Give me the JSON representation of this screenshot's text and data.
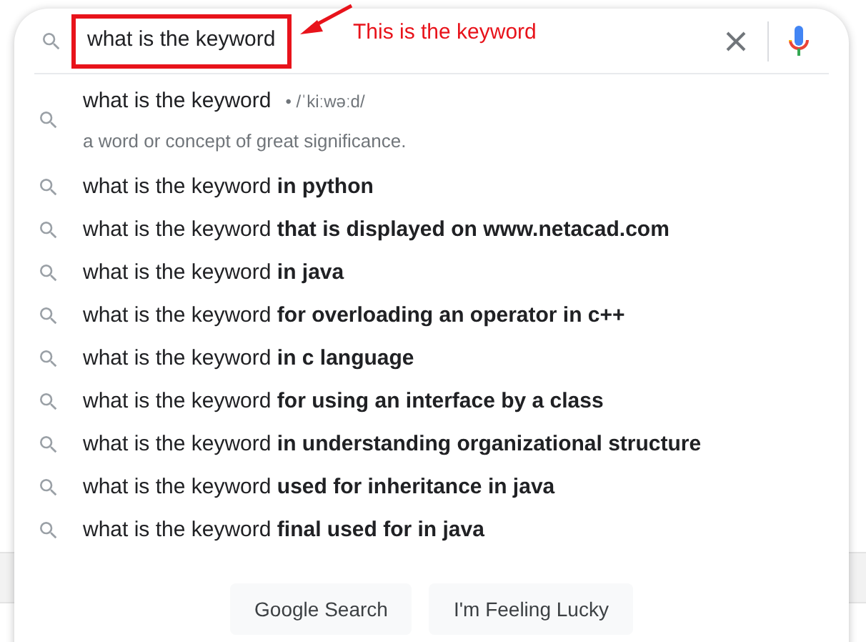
{
  "search": {
    "value": "what is the keyword"
  },
  "annotation": {
    "text": "This is the keyword"
  },
  "definition": {
    "term": "what is the keyword",
    "pronunciation": "• /ˈkiːwəːd/",
    "meaning": "a word or concept of great significance."
  },
  "suggestions": [
    "what is the keyword **in python**",
    "what is the keyword **that is displayed on www.netacad.com**",
    "what is the keyword **in java**",
    "what is the keyword **for overloading an operator in c++**",
    "what is the keyword **in c language**",
    "what is the keyword **for using an interface by a class**",
    "what is the keyword **in understanding organizational structure**",
    "what is the keyword **used for inheritance in java**",
    "what is the keyword **final used for in java**"
  ],
  "buttons": [
    "Google Search",
    "I'm Feeling Lucky"
  ]
}
